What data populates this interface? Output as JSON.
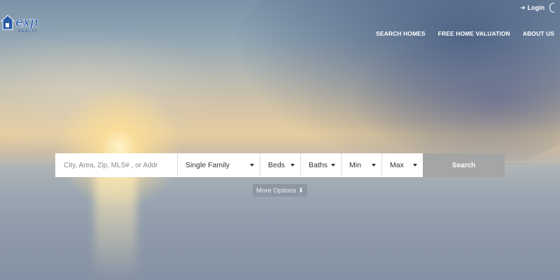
{
  "header": {
    "logo": {
      "text": "exp",
      "subtext": "REALTY",
      "icon": "house-icon"
    },
    "login_label": "Login",
    "nav": [
      {
        "label": "SEARCH HOMES"
      },
      {
        "label": "FREE HOME VALUATION"
      },
      {
        "label": "ABOUT US"
      }
    ]
  },
  "search": {
    "placeholder": "City, Area, Zip, MLS# , or Addr",
    "property_type": "Single Family",
    "beds": "Beds",
    "baths": "Baths",
    "min_price": "Min",
    "max_price": "Max",
    "button_label": "Search",
    "more_options_label": "More Options"
  },
  "colors": {
    "search_button": "#a5a5a5",
    "more_options": "#8e97a4",
    "logo_blue": "#2a5aa8"
  }
}
